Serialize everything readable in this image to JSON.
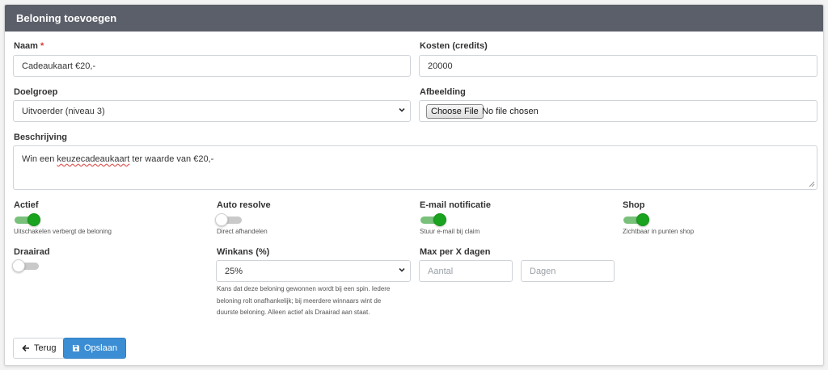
{
  "header": {
    "title": "Beloning toevoegen"
  },
  "fields": {
    "naam": {
      "label": "Naam",
      "required_mark": "*",
      "value": "Cadeaukaart €20,-"
    },
    "kosten": {
      "label": "Kosten (credits)",
      "value": "20000"
    },
    "doelgroep": {
      "label": "Doelgroep",
      "selected": "Uitvoerder (niveau 3)"
    },
    "afbeelding": {
      "label": "Afbeelding",
      "button_label": "Choose File",
      "status": "No file chosen"
    },
    "beschrijving": {
      "label": "Beschrijving",
      "value_before": "Win een ",
      "value_misspelled": "keuzecadeaukaart",
      "value_after": " ter waarde van €20,-"
    }
  },
  "toggles": [
    {
      "label": "Actief",
      "on": true,
      "hint": "Uitschakelen verbergt de beloning"
    },
    {
      "label": "Auto resolve",
      "on": false,
      "hint": "Direct afhandelen"
    },
    {
      "label": "E-mail notificatie",
      "on": true,
      "hint": "Stuur e-mail bij claim"
    },
    {
      "label": "Shop",
      "on": true,
      "hint": "Zichtbaar in punten shop"
    },
    {
      "label": "Draairad",
      "on": false
    }
  ],
  "winkans": {
    "label": "Winkans (%)",
    "selected": "25%",
    "help": [
      "Kans dat deze beloning gewonnen wordt bij een spin. Iedere",
      "beloning rolt onafhankelijk; bij meerdere winnaars wint de",
      "duurste beloning. Alleen actief als Draairad aan staat."
    ]
  },
  "max_per": {
    "label": "Max per X dagen",
    "aantal_placeholder": "Aantal",
    "dagen_placeholder": "Dagen"
  },
  "actions": {
    "back_label": "Terug",
    "save_label": "Opslaan",
    "back_icon": "arrow-left-icon",
    "save_icon": "floppy-disk-icon"
  },
  "colors": {
    "header_bg": "#5b5f69",
    "toggle_on": "#1aa31e",
    "primary": "#3c8ed4",
    "required": "#e03131"
  }
}
